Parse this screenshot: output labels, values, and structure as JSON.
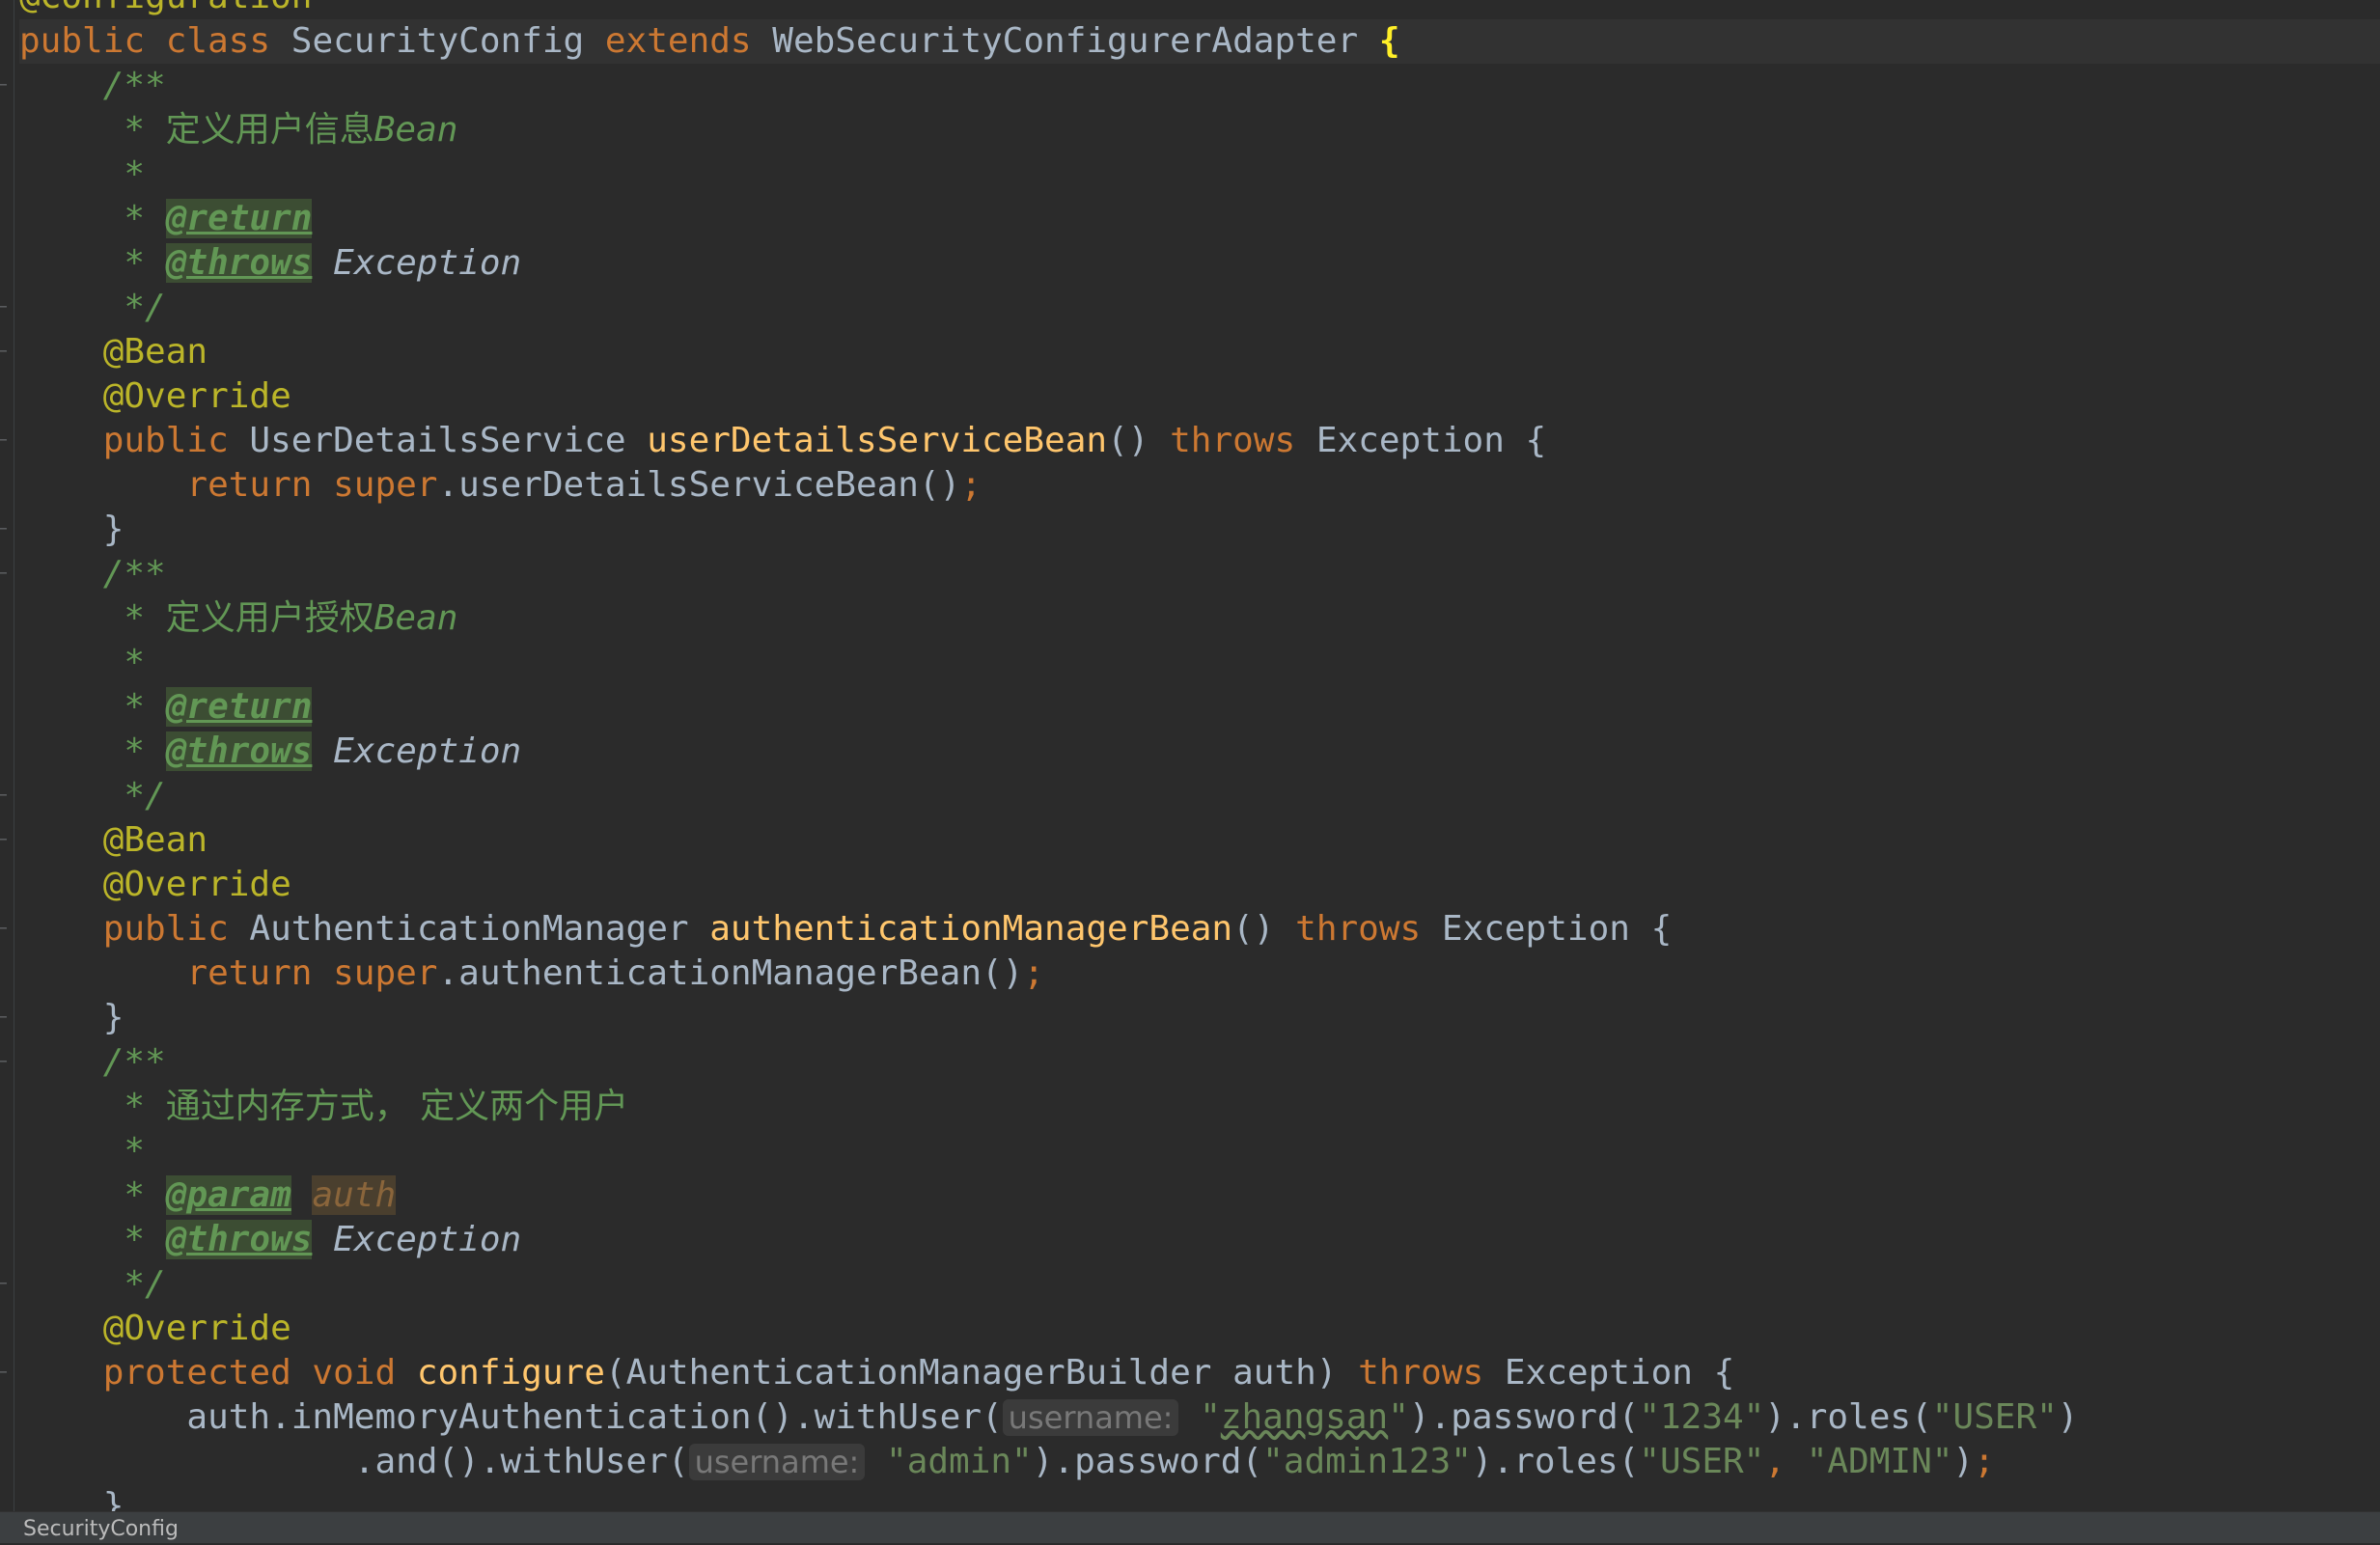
{
  "editor": {
    "lines": [
      {
        "segs": [
          [
            "ann",
            "@Configuration"
          ]
        ]
      },
      {
        "cur": true,
        "segs": [
          [
            "kw",
            "public class "
          ],
          [
            "cls",
            "SecurityConfig "
          ],
          [
            "kw",
            "extends "
          ],
          [
            "cls",
            "WebSecurityConfigurerAdapter "
          ],
          [
            "brace-hl",
            "{"
          ]
        ]
      },
      {
        "segs": [
          [
            "cm",
            "    /**"
          ]
        ]
      },
      {
        "segs": [
          [
            "cm",
            "     * "
          ],
          [
            "cm cjk",
            "定义用户信息"
          ],
          [
            "cm",
            "Bean"
          ]
        ]
      },
      {
        "segs": [
          [
            "cm",
            "     *"
          ]
        ]
      },
      {
        "segs": [
          [
            "cm",
            "     * "
          ],
          [
            "tag",
            "@return"
          ]
        ]
      },
      {
        "segs": [
          [
            "cm",
            "     * "
          ],
          [
            "tag",
            "@throws"
          ],
          [
            "cm",
            " "
          ],
          [
            "exc",
            "Exception"
          ]
        ]
      },
      {
        "segs": [
          [
            "cm",
            "     */"
          ]
        ]
      },
      {
        "segs": [
          [
            "ann",
            "    @Bean"
          ]
        ]
      },
      {
        "segs": [
          [
            "ann",
            "    @Override"
          ]
        ]
      },
      {
        "segs": [
          [
            "kw",
            "    public "
          ],
          [
            "cls",
            "UserDetailsService "
          ],
          [
            "fn",
            "userDetailsServiceBean"
          ],
          [
            "cls",
            "() "
          ],
          [
            "kw",
            "throws "
          ],
          [
            "cls",
            "Exception {"
          ]
        ]
      },
      {
        "segs": [
          [
            "kw",
            "        return super"
          ],
          [
            "cls",
            ".userDetailsServiceBean()"
          ],
          [
            "punc",
            ";"
          ]
        ]
      },
      {
        "segs": [
          [
            "cls",
            "    }"
          ]
        ]
      },
      {
        "segs": [
          [
            "cm",
            "    /**"
          ]
        ]
      },
      {
        "segs": [
          [
            "cm",
            "     * "
          ],
          [
            "cm cjk",
            "定义用户授权"
          ],
          [
            "cm",
            "Bean"
          ]
        ]
      },
      {
        "segs": [
          [
            "cm",
            "     *"
          ]
        ]
      },
      {
        "segs": [
          [
            "cm",
            "     * "
          ],
          [
            "tag",
            "@return"
          ]
        ]
      },
      {
        "segs": [
          [
            "cm",
            "     * "
          ],
          [
            "tag",
            "@throws"
          ],
          [
            "cm",
            " "
          ],
          [
            "exc",
            "Exception"
          ]
        ]
      },
      {
        "segs": [
          [
            "cm",
            "     */"
          ]
        ]
      },
      {
        "segs": [
          [
            "ann",
            "    @Bean"
          ]
        ]
      },
      {
        "segs": [
          [
            "ann",
            "    @Override"
          ]
        ]
      },
      {
        "segs": [
          [
            "kw",
            "    public "
          ],
          [
            "cls",
            "AuthenticationManager "
          ],
          [
            "fn",
            "authenticationManagerBean"
          ],
          [
            "cls",
            "() "
          ],
          [
            "kw",
            "throws "
          ],
          [
            "cls",
            "Exception {"
          ]
        ]
      },
      {
        "segs": [
          [
            "kw",
            "        return super"
          ],
          [
            "cls",
            ".authenticationManagerBean()"
          ],
          [
            "punc",
            ";"
          ]
        ]
      },
      {
        "segs": [
          [
            "cls",
            "    }"
          ]
        ]
      },
      {
        "segs": [
          [
            "cm",
            "    /**"
          ]
        ]
      },
      {
        "segs": [
          [
            "cm",
            "     * "
          ],
          [
            "cm cjk",
            "通过内存方式， 定义两个用户"
          ]
        ]
      },
      {
        "segs": [
          [
            "cm",
            "     *"
          ]
        ]
      },
      {
        "segs": [
          [
            "cm",
            "     * "
          ],
          [
            "tag",
            "@param"
          ],
          [
            "cm",
            " "
          ],
          [
            "pname",
            "auth"
          ]
        ]
      },
      {
        "segs": [
          [
            "cm",
            "     * "
          ],
          [
            "tag",
            "@throws"
          ],
          [
            "cm",
            " "
          ],
          [
            "exc",
            "Exception"
          ]
        ]
      },
      {
        "segs": [
          [
            "cm",
            "     */"
          ]
        ]
      },
      {
        "segs": [
          [
            "ann",
            "    @Override"
          ]
        ]
      },
      {
        "segs": [
          [
            "kw",
            "    protected void "
          ],
          [
            "fn",
            "configure"
          ],
          [
            "cls",
            "(AuthenticationManagerBuilder auth) "
          ],
          [
            "kw",
            "throws "
          ],
          [
            "cls",
            "Exception {"
          ]
        ]
      },
      {
        "segs": [
          [
            "cls",
            "        auth.inMemoryAuthentication().withUser("
          ],
          [
            "hint",
            "username:"
          ],
          [
            "cls",
            " "
          ],
          [
            "str",
            "\""
          ],
          [
            "str squig",
            "zhangsan"
          ],
          [
            "str",
            "\""
          ],
          [
            "cls",
            ").password("
          ],
          [
            "str",
            "\"1234\""
          ],
          [
            "cls",
            ").roles("
          ],
          [
            "str",
            "\"USER\""
          ],
          [
            "cls",
            ")"
          ]
        ]
      },
      {
        "segs": [
          [
            "cls",
            "                .and().withUser("
          ],
          [
            "hint",
            "username:"
          ],
          [
            "cls",
            " "
          ],
          [
            "str",
            "\"admin\""
          ],
          [
            "cls",
            ").password("
          ],
          [
            "str",
            "\"admin123\""
          ],
          [
            "cls",
            ").roles("
          ],
          [
            "str",
            "\"USER\""
          ],
          [
            "punc",
            ", "
          ],
          [
            "str",
            "\"ADMIN\""
          ],
          [
            "cls",
            ")"
          ],
          [
            "punc",
            ";"
          ]
        ]
      },
      {
        "segs": [
          [
            "cls",
            "    }"
          ]
        ]
      }
    ]
  },
  "statusbar": {
    "breadcrumb": "SecurityConfig"
  }
}
